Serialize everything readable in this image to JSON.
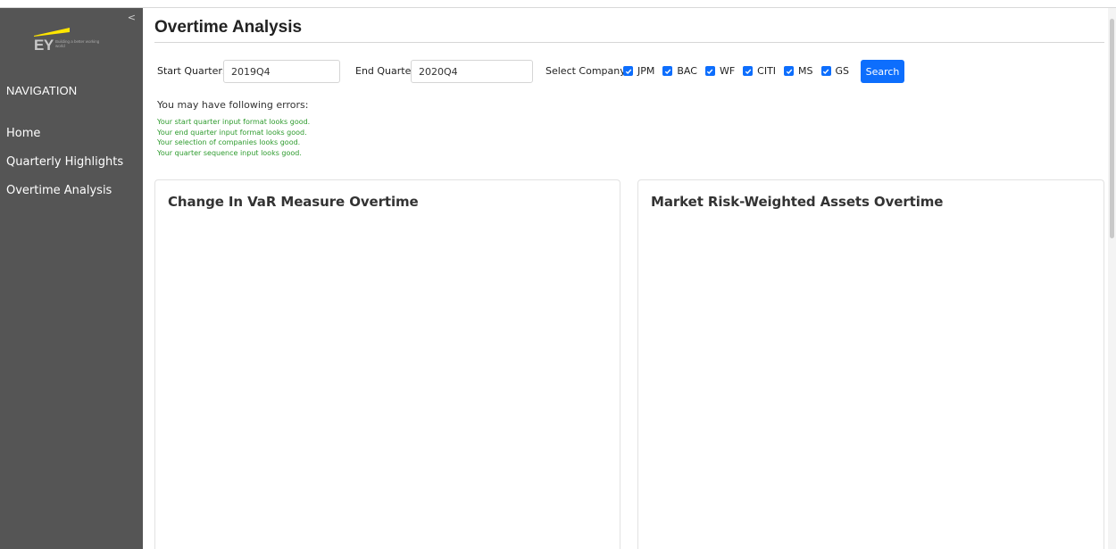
{
  "sidebar": {
    "collapse_glyph": "<",
    "logo": {
      "mark": "EY",
      "tagline": "Building a better working world",
      "accent": "#ffe600"
    },
    "nav_heading": "NAVIGATION",
    "items": [
      {
        "label": "Home"
      },
      {
        "label": "Quarterly Highlights"
      },
      {
        "label": "Overtime Analysis"
      }
    ]
  },
  "page": {
    "title": "Overtime Analysis"
  },
  "filters": {
    "start_label": "Start Quarter:",
    "start_value": "2019Q4",
    "end_label": "End Quarter:",
    "end_value": "2020Q4",
    "company_label": "Select Company:",
    "companies": [
      {
        "name": "JPM",
        "checked": true
      },
      {
        "name": "BAC",
        "checked": true
      },
      {
        "name": "WF",
        "checked": true
      },
      {
        "name": "CITI",
        "checked": true
      },
      {
        "name": "MS",
        "checked": true
      },
      {
        "name": "GS",
        "checked": true
      }
    ],
    "search_label": "Search"
  },
  "errors": {
    "title": "You may have following errors:",
    "messages": [
      "Your start quarter input format looks good.",
      "Your end quarter input format looks good.",
      "Your selection of companies looks good.",
      "Your quarter sequence input looks good."
    ]
  },
  "cards": [
    {
      "title": "Change In VaR Measure Overtime"
    },
    {
      "title": "Market Risk-Weighted Assets Overtime"
    }
  ],
  "colors": {
    "sidebar_bg": "#555555",
    "primary": "#0d6efd",
    "success_text": "#2e9b2e"
  },
  "icons": {
    "checkbox": "check-icon",
    "collapse": "chevron-left-icon"
  }
}
